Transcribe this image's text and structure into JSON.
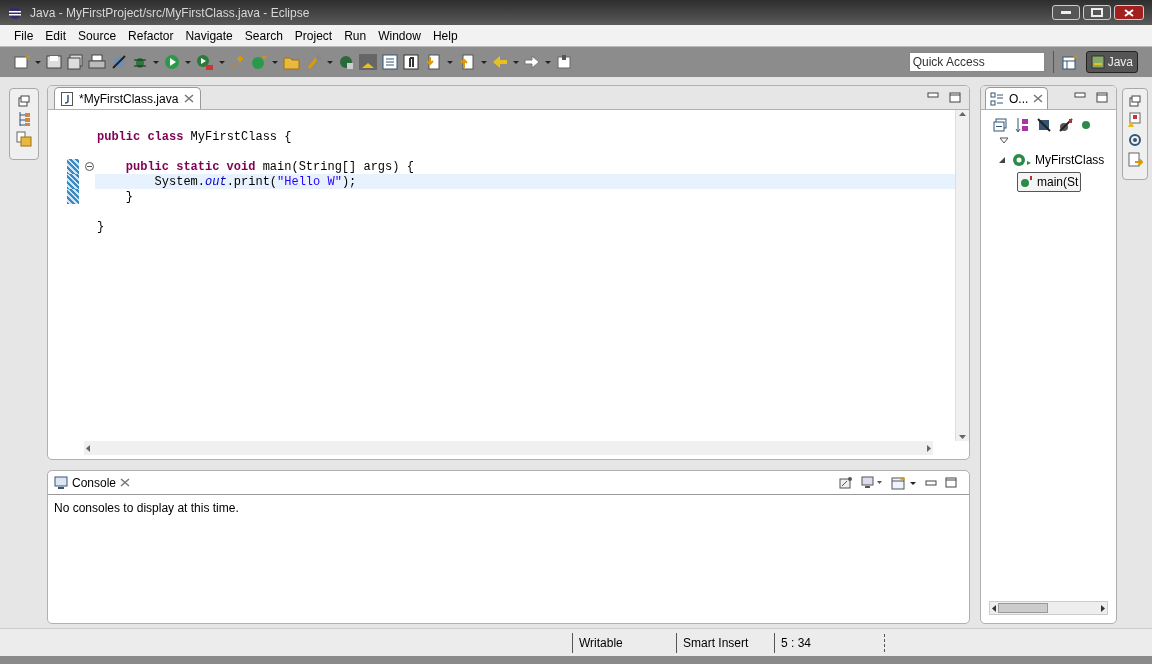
{
  "window": {
    "title": "Java - MyFirstProject/src/MyFirstClass.java - Eclipse"
  },
  "menu": [
    "File",
    "Edit",
    "Source",
    "Refactor",
    "Navigate",
    "Search",
    "Project",
    "Run",
    "Window",
    "Help"
  ],
  "quick_access": {
    "placeholder": "Quick Access"
  },
  "perspectives": [
    {
      "label": "Java",
      "selected": true
    }
  ],
  "editor": {
    "tabs": [
      {
        "label": "*MyFirstClass.java",
        "selected": true
      }
    ],
    "lines": [
      {
        "kind": "blank"
      },
      {
        "kind": "code",
        "fold": false,
        "current": false,
        "changed": false,
        "segments": [
          {
            "text": "public class",
            "kind": "keyword"
          },
          {
            "text": " MyFirstClass {",
            "kind": "plain"
          }
        ]
      },
      {
        "kind": "blank"
      },
      {
        "kind": "code",
        "fold": true,
        "current": false,
        "changed": true,
        "segments": [
          {
            "text": "    public static void",
            "kind": "keyword"
          },
          {
            "text": " main(String[] args) {",
            "kind": "plain"
          }
        ]
      },
      {
        "kind": "code",
        "fold": false,
        "current": true,
        "changed": true,
        "segments": [
          {
            "text": "        System.",
            "kind": "plain"
          },
          {
            "text": "out",
            "kind": "field"
          },
          {
            "text": ".print(",
            "kind": "plain"
          },
          {
            "text": "\"Hello W\"",
            "kind": "string"
          },
          {
            "text": ");",
            "kind": "plain"
          }
        ]
      },
      {
        "kind": "code",
        "fold": false,
        "current": false,
        "changed": true,
        "segments": [
          {
            "text": "    }",
            "kind": "plain"
          }
        ]
      },
      {
        "kind": "blank"
      },
      {
        "kind": "code",
        "fold": false,
        "current": false,
        "changed": false,
        "segments": [
          {
            "text": "}",
            "kind": "plain"
          }
        ]
      }
    ]
  },
  "outline": {
    "title": "O...",
    "tree": [
      {
        "label": "MyFirstClass",
        "expanded": true,
        "selected": false,
        "children": [
          {
            "label": "main(St",
            "selected": true
          }
        ]
      }
    ]
  },
  "console": {
    "title": "Console",
    "message": "No consoles to display at this time."
  },
  "status_bar": [
    "Writable",
    "Smart Insert",
    "5 : 34"
  ]
}
